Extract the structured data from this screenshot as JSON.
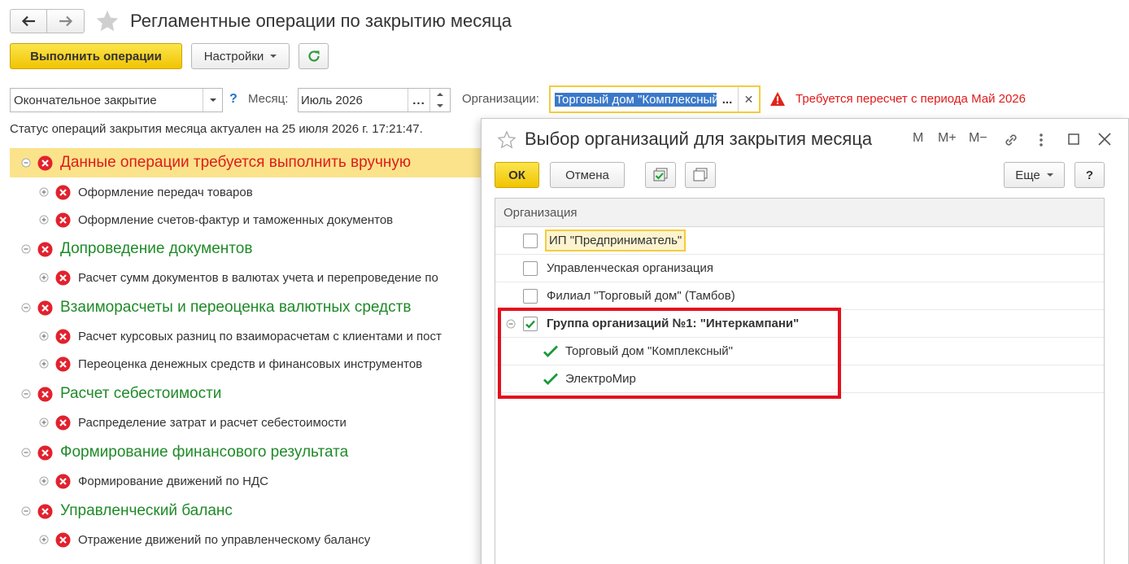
{
  "header": {
    "title": "Регламентные операции по закрытию месяца",
    "run_label": "Выполнить операции",
    "settings_label": "Настройки"
  },
  "filters": {
    "mode_value": "Окончательное закрытие",
    "help": "?",
    "month_label": "Месяц:",
    "month_value": "Июль 2026",
    "dots": "...",
    "org_label": "Организации:",
    "org_value": "Торговый дом \"Комплексный\"",
    "warning": "Требуется пересчет с периода Май 2026"
  },
  "status": "Статус операций закрытия месяца актуален на 25 июля 2026 г. 17:21:47.",
  "tree": [
    {
      "label": "Данные операции требуется выполнить вручную",
      "level": "group",
      "color": "red",
      "selected": true
    },
    {
      "label": "Оформление передач товаров",
      "level": "child"
    },
    {
      "label": "Оформление счетов-фактур и таможенных документов",
      "level": "child"
    },
    {
      "label": "Допроведение документов",
      "level": "group"
    },
    {
      "label": "Расчет сумм документов в валютах учета и перепроведение по",
      "level": "child"
    },
    {
      "label": "Взаиморасчеты и переоценка валютных средств",
      "level": "group"
    },
    {
      "label": "Расчет курсовых разниц по взаиморасчетам с клиентами и пост",
      "level": "child"
    },
    {
      "label": "Переоценка денежных средств и финансовых инструментов",
      "level": "child"
    },
    {
      "label": "Расчет себестоимости",
      "level": "group"
    },
    {
      "label": "Распределение затрат и расчет себестоимости",
      "level": "child"
    },
    {
      "label": "Формирование финансового результата",
      "level": "group"
    },
    {
      "label": "Формирование движений по НДС",
      "level": "child"
    },
    {
      "label": "Управленческий баланс",
      "level": "group"
    },
    {
      "label": "Отражение движений по управленческому балансу",
      "level": "child"
    }
  ],
  "dialog": {
    "title": "Выбор организаций для закрытия месяца",
    "tools": {
      "m": "M",
      "mplus": "M+",
      "mminus": "M−"
    },
    "ok_label": "ОК",
    "cancel_label": "Отмена",
    "more_label": "Еще",
    "help_label": "?",
    "column_header": "Организация",
    "rows": [
      {
        "label": "ИП \"Предприниматель\"",
        "checked": false,
        "type": "item",
        "selected": true
      },
      {
        "label": "Управленческая организация",
        "checked": false,
        "type": "item"
      },
      {
        "label": "Филиал \"Торговый дом\" (Тамбов)",
        "checked": false,
        "type": "item"
      },
      {
        "label": "Группа организаций №1: \"Интеркампани\"",
        "checked": true,
        "type": "group"
      },
      {
        "label": "Торговый дом \"Комплексный\"",
        "checked": true,
        "type": "sub"
      },
      {
        "label": "ЭлектроМир",
        "checked": true,
        "type": "sub"
      }
    ]
  },
  "colors": {
    "accent_yellow": "#f1c400",
    "error_red": "#e01b1b",
    "group_green": "#1f8a28",
    "check_green": "#1a9a3a",
    "highlight_red": "#e3101d"
  }
}
